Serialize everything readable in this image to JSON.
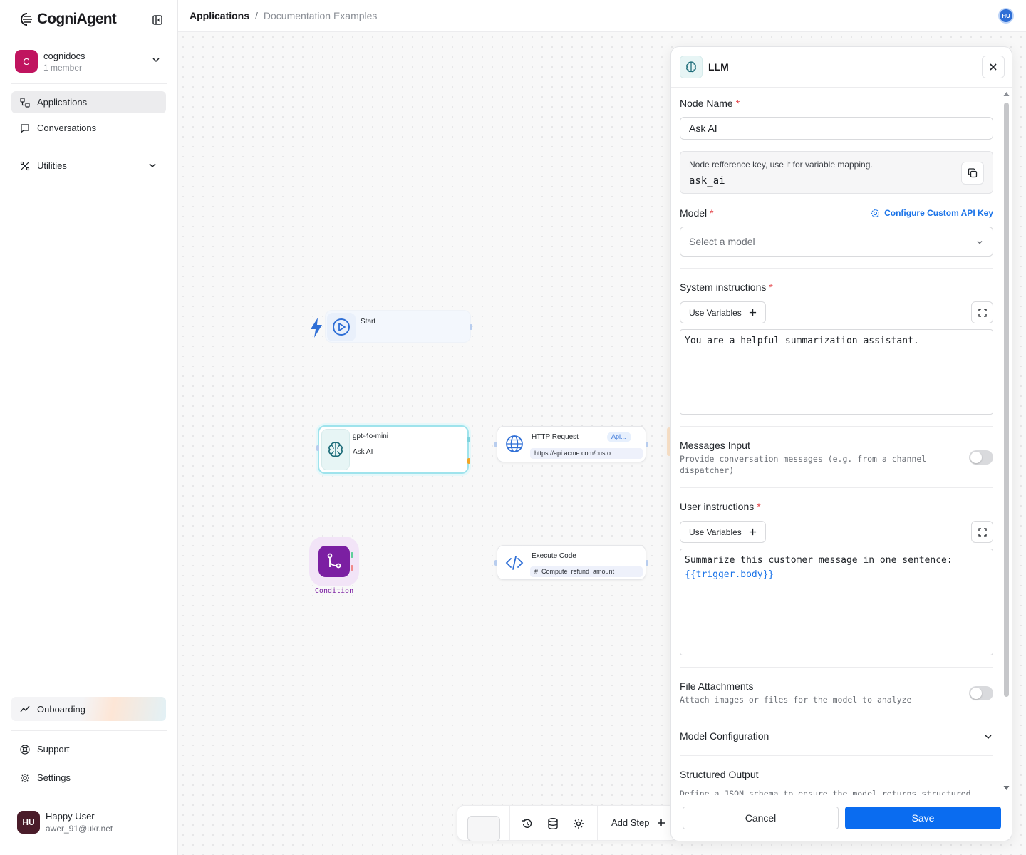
{
  "brand": {
    "name": "CogniAgent"
  },
  "workspace": {
    "initial": "C",
    "name": "cognidocs",
    "members": "1 member"
  },
  "nav": {
    "applications": "Applications",
    "conversations": "Conversations",
    "utilities": "Utilities",
    "onboarding": "Onboarding",
    "support": "Support",
    "settings": "Settings"
  },
  "user": {
    "initials": "HU",
    "name": "Happy User",
    "email": "awer_91@ukr.net"
  },
  "header": {
    "crumb_root": "Applications",
    "crumb_sep": "/",
    "crumb_current": "Documentation Examples",
    "avatar": "HU"
  },
  "canvas": {
    "start": {
      "title": "Start"
    },
    "llm_node": {
      "title": "gpt-4o-mini",
      "subtitle": "Ask AI"
    },
    "http_node": {
      "title": "HTTP Request",
      "tag": "Api...",
      "url": "https://api.acme.com/custo..."
    },
    "condition_node": {
      "label": "Condition"
    },
    "code_node": {
      "title": "Execute Code",
      "code": "#  Compute  refund  amount"
    }
  },
  "toolbar": {
    "add_step": "Add Step"
  },
  "panel": {
    "title": "LLM",
    "node_name_label": "Node Name",
    "node_name_value": "Ask AI",
    "ref_hint": "Node refference key, use it for variable mapping.",
    "ref_key": "ask_ai",
    "model_label": "Model",
    "configure_api_key": "Configure Custom API Key",
    "model_placeholder": "Select a model",
    "system_label": "System instructions",
    "use_variables": "Use Variables",
    "system_text": "You are a helpful summarization assistant.",
    "messages_label": "Messages Input",
    "messages_desc": "Provide conversation messages (e.g. from a channel dispatcher)",
    "user_label": "User instructions",
    "user_text": "Summarize this customer message in one sentence:",
    "user_var": "{{trigger.body}}",
    "files_label": "File Attachments",
    "files_desc": "Attach images or files for the model to analyze",
    "model_config_label": "Model Configuration",
    "structured_label": "Structured Output",
    "structured_desc": "Define a JSON schema to ensure the model returns structured",
    "required_mark": "*",
    "cancel": "Cancel",
    "save": "Save"
  },
  "colors": {
    "accent": "#0a6cf0",
    "workspace": "#c0145f",
    "condition": "#7b1fa2",
    "required": "#e5484d"
  }
}
